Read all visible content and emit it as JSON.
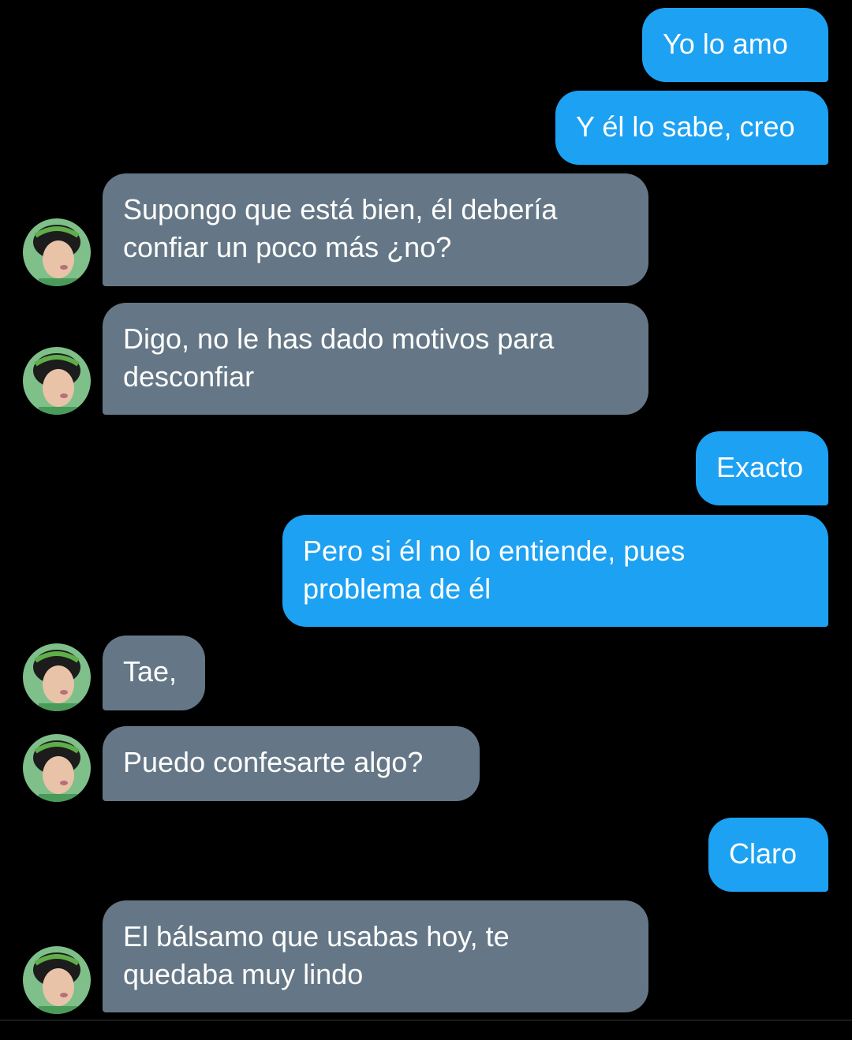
{
  "messages": [
    {
      "from": "me",
      "text": "Yo lo amo"
    },
    {
      "from": "me",
      "text": "Y él lo sabe, creo"
    },
    {
      "from": "contact",
      "text": "Supongo que está bien, él debería\nconfiar un poco más ¿no?"
    },
    {
      "from": "contact",
      "text": "Digo, no le has dado motivos para\ndesconfiar"
    },
    {
      "from": "me",
      "text": "Exacto"
    },
    {
      "from": "me",
      "text": "Pero si él no lo entiende, pues\nproblema de él"
    },
    {
      "from": "contact",
      "text": "Tae,"
    },
    {
      "from": "contact",
      "text": "Puedo confesarte algo?"
    },
    {
      "from": "me",
      "text": "Claro"
    },
    {
      "from": "contact",
      "text": "El bálsamo que usabas hoy, te\nquedaba muy lindo"
    }
  ],
  "colors": {
    "background": "#000000",
    "sent_bubble": "#1da1f2",
    "received_bubble": "#657786",
    "text": "#ffffff"
  },
  "icons": {
    "contact_avatar": "contact-avatar-photo"
  }
}
